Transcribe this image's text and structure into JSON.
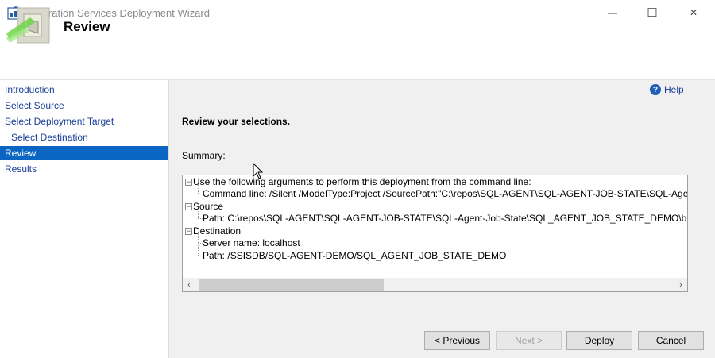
{
  "window": {
    "title": "Integration Services Deployment Wizard",
    "minimize_glyph": "—",
    "maximize_glyph": "☐",
    "close_glyph": "✕"
  },
  "header": {
    "title": "Review"
  },
  "nav": {
    "items": [
      {
        "label": "Introduction",
        "indent": false,
        "active": false
      },
      {
        "label": "Select Source",
        "indent": false,
        "active": false
      },
      {
        "label": "Select Deployment Target",
        "indent": false,
        "active": false
      },
      {
        "label": "Select Destination",
        "indent": true,
        "active": false
      },
      {
        "label": "Review",
        "indent": false,
        "active": true
      },
      {
        "label": "Results",
        "indent": false,
        "active": false
      }
    ]
  },
  "help": {
    "label": "Help",
    "icon": "?"
  },
  "main": {
    "heading": "Review your selections.",
    "summary_label": "Summary:",
    "tree": [
      {
        "text": "Use the following arguments to perform this deployment from the command line:",
        "level": 0
      },
      {
        "text": "Command line: /Silent /ModelType:Project /SourcePath:\"C:\\repos\\SQL-AGENT\\SQL-AGENT-JOB-STATE\\SQL-Agent-",
        "level": 1
      },
      {
        "text": "Source",
        "level": 0
      },
      {
        "text": "Path: C:\\repos\\SQL-AGENT\\SQL-AGENT-JOB-STATE\\SQL-Agent-Job-State\\SQL_AGENT_JOB_STATE_DEMO\\bin\\",
        "level": 1
      },
      {
        "text": "Destination",
        "level": 0
      },
      {
        "text": "Server name: localhost",
        "level": 1
      },
      {
        "text": "Path: /SSISDB/SQL-AGENT-DEMO/SQL_AGENT_JOB_STATE_DEMO",
        "level": 1
      }
    ],
    "scroll_left": "‹",
    "scroll_right": "›"
  },
  "buttons": {
    "previous": "< Previous",
    "next": "Next >",
    "deploy": "Deploy",
    "cancel": "Cancel"
  },
  "colors": {
    "accent": "#0a66c2",
    "link": "#1a3f9a"
  }
}
